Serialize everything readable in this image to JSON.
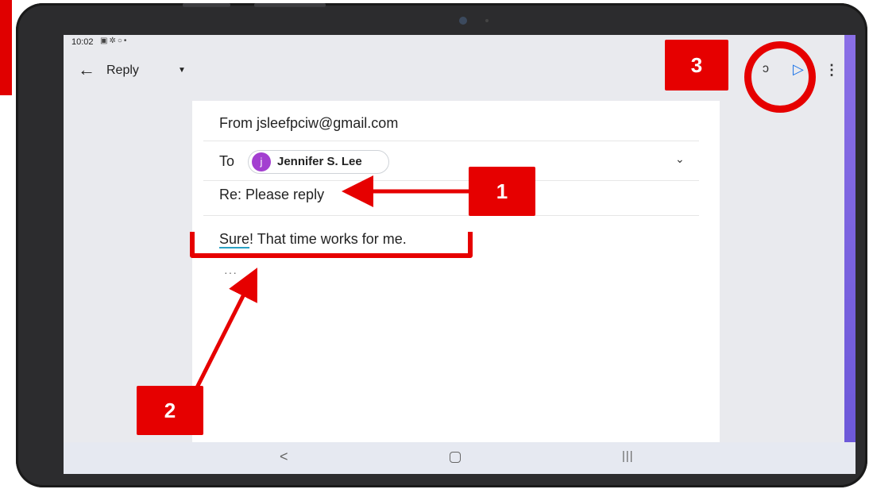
{
  "status_bar": {
    "time": "10:02",
    "icons": [
      "gallery-icon",
      "settings-icon",
      "sync-icon",
      "dot"
    ]
  },
  "app_bar": {
    "title": "Reply",
    "send_icon": "send-icon",
    "more_icon": "more-vert-icon"
  },
  "compose": {
    "from_text": "From jsleefpciw@gmail.com",
    "to_label": "To",
    "recipient_initial": "j",
    "recipient_name": "Jennifer S. Lee",
    "subject": "Re: Please reply",
    "body_spell_word": "Sure",
    "body_rest": "! That time works for me.",
    "quoted_indicator": "···"
  },
  "nav_bar": {
    "back": "<",
    "recent": "|||"
  },
  "callouts": {
    "one": "1",
    "two": "2",
    "three": "3"
  },
  "colors": {
    "annotation_red": "#e60000",
    "send_blue": "#1a73e8",
    "avatar_purple": "#a33fd0"
  }
}
